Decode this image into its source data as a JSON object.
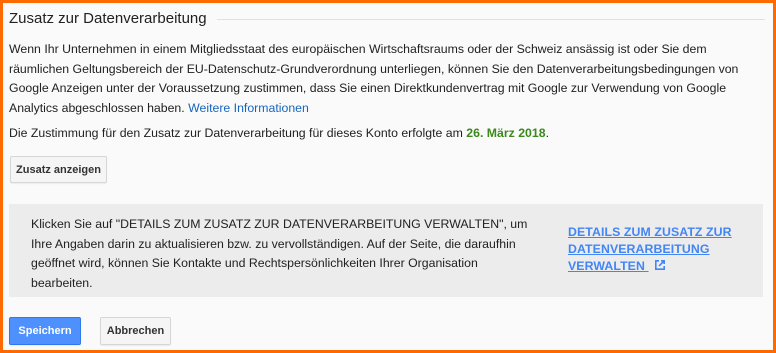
{
  "section": {
    "title": "Zusatz zur Datenverarbeitung"
  },
  "intro": {
    "text": "Wenn Ihr Unternehmen in einem Mitgliedsstaat des europäischen Wirtschaftsraums oder der Schweiz ansässig ist oder Sie dem räumlichen Geltungsbereich der EU-Datenschutz-Grundverordnung unterliegen, können Sie den Datenverarbeitungsbedingungen von Google Anzeigen unter der Voraussetzung zustimmen, dass Sie einen Direktkundenvertrag mit Google zur Verwendung von Google Analytics abgeschlossen haben.",
    "more_link": "Weitere Informationen"
  },
  "consent": {
    "prefix": "Die Zustimmung für den Zusatz zur Datenverarbeitung für dieses Konto erfolgte am",
    "date": "26. März 2018",
    "suffix": "."
  },
  "buttons": {
    "show_addendum": "Zusatz anzeigen",
    "save": "Speichern",
    "cancel": "Abbrechen"
  },
  "details_box": {
    "text": "Klicken Sie auf \"DETAILS ZUM ZUSATZ ZUR DATENVERARBEITUNG VERWALTEN\", um Ihre Angaben darin zu aktualisieren bzw. zu vervollständigen. Auf der Seite, die daraufhin geöffnet wird, können Sie Kontakte und Rechtspersönlichkeiten Ihrer Organisation bearbeiten.",
    "link_label": "DETAILS ZUM ZUSATZ ZUR DATENVERARBEITUNG VERWALTEN",
    "link_icon": "open-in-new-icon"
  },
  "colors": {
    "frame": "#ff6a00",
    "link": "#1565c0",
    "date": "#3a8a1c",
    "primary_button": "#4d90fe",
    "details_link": "#4285f4"
  }
}
